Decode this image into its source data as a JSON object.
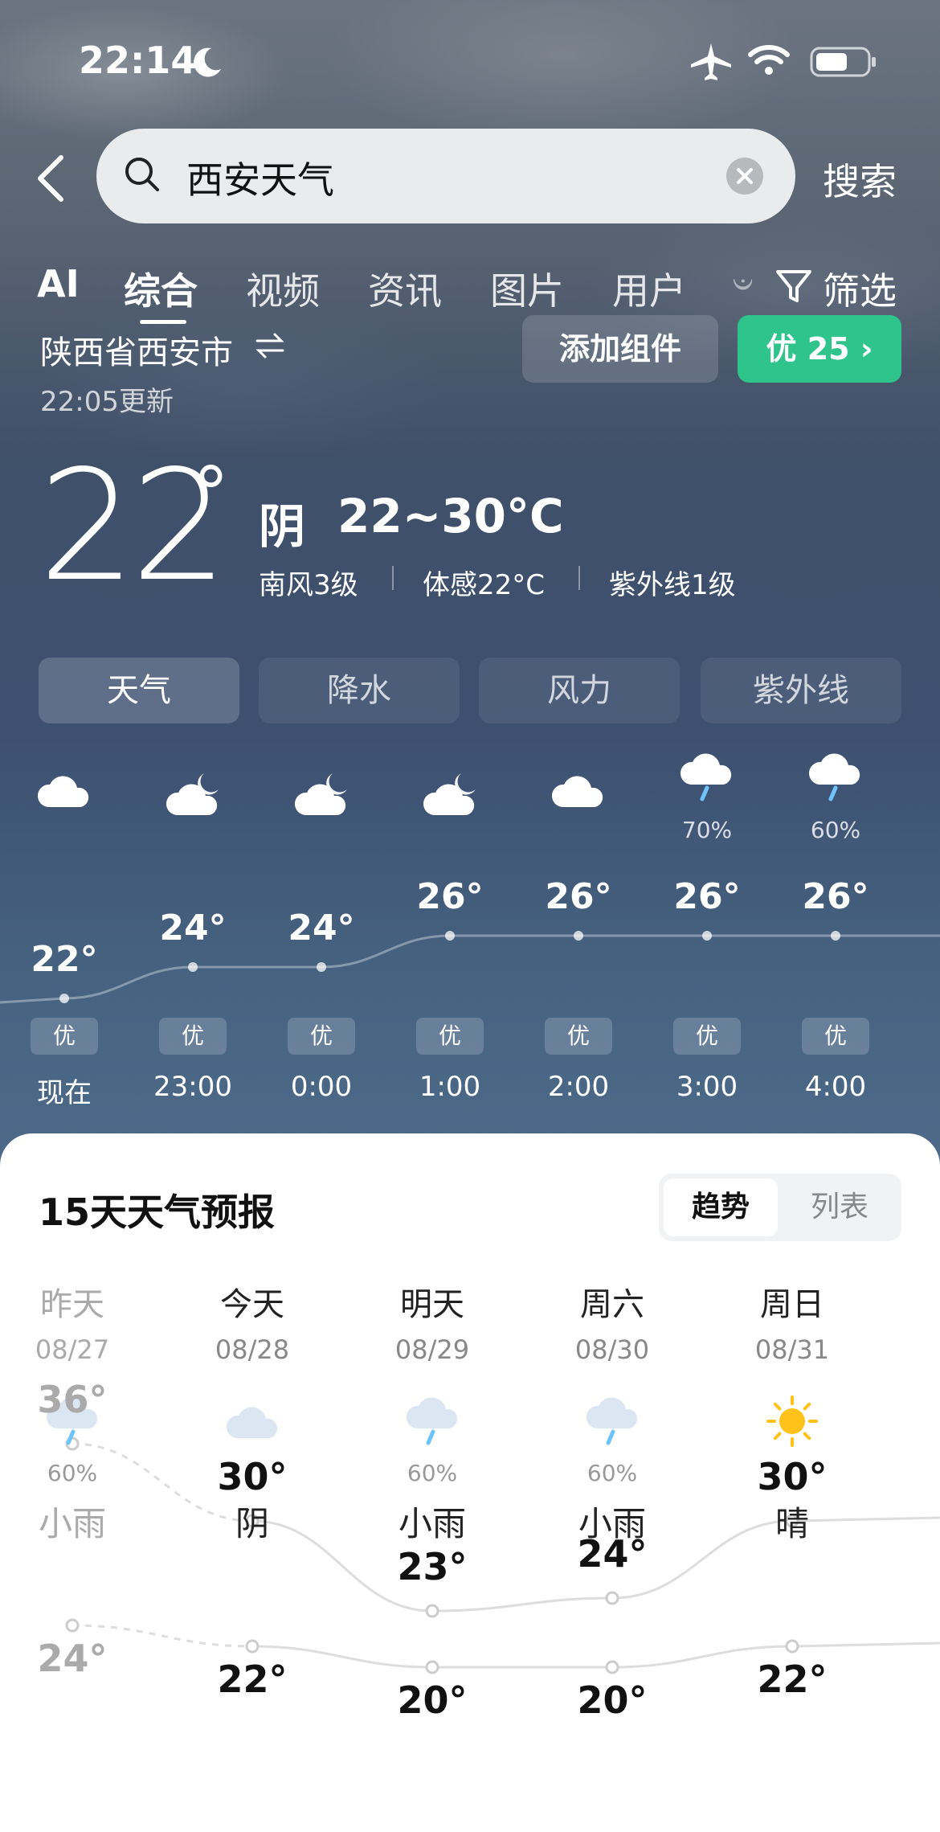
{
  "status_bar": {
    "time": "22:14"
  },
  "search": {
    "query": "西安天气",
    "submit_label": "搜索"
  },
  "tabs": [
    "AI",
    "综合",
    "视频",
    "资讯",
    "图片",
    "用户",
    "𝄑"
  ],
  "filter_label": "筛选",
  "location": {
    "name": "陕西省西安市",
    "updated": "22:05更新"
  },
  "widget_btn": "添加组件",
  "aqi_btn": "优 25 ›",
  "current": {
    "temp": "22",
    "degree": "°",
    "condition": "阴",
    "range": "22~30°C",
    "wind": "南风3级",
    "feels": "体感22°C",
    "uv": "紫外线1级"
  },
  "segments": [
    "天气",
    "降水",
    "风力",
    "紫外线"
  ],
  "hourly": [
    {
      "time": "现在",
      "temp": "22°",
      "aq": "优",
      "icon": "cloud-icon",
      "pct": ""
    },
    {
      "time": "23:00",
      "temp": "24°",
      "aq": "优",
      "icon": "cloud-moon-icon",
      "pct": ""
    },
    {
      "time": "0:00",
      "temp": "24°",
      "aq": "优",
      "icon": "cloud-moon-icon",
      "pct": ""
    },
    {
      "time": "1:00",
      "temp": "26°",
      "aq": "优",
      "icon": "cloud-moon-icon",
      "pct": ""
    },
    {
      "time": "2:00",
      "temp": "26°",
      "aq": "优",
      "icon": "cloud-icon",
      "pct": ""
    },
    {
      "time": "3:00",
      "temp": "26°",
      "aq": "优",
      "icon": "rain-icon",
      "pct": "70%"
    },
    {
      "time": "4:00",
      "temp": "26°",
      "aq": "优",
      "icon": "rain-icon",
      "pct": "60%"
    }
  ],
  "forecast": {
    "title": "15天天气预报",
    "toggle": [
      "趋势",
      "列表"
    ],
    "days": [
      {
        "name": "昨天",
        "date": "08/27",
        "cond": "小雨",
        "pct": "60%",
        "icon": "rain-icon",
        "high": "36°",
        "low": "24°"
      },
      {
        "name": "今天",
        "date": "08/28",
        "cond": "阴",
        "pct": "",
        "icon": "cloud-icon",
        "high": "30°",
        "low": "22°"
      },
      {
        "name": "明天",
        "date": "08/29",
        "cond": "小雨",
        "pct": "60%",
        "icon": "rain-icon",
        "high": "23°",
        "low": "20°"
      },
      {
        "name": "周六",
        "date": "08/30",
        "cond": "小雨",
        "pct": "60%",
        "icon": "rain-icon",
        "high": "24°",
        "low": "20°"
      },
      {
        "name": "周日",
        "date": "08/31",
        "cond": "晴",
        "pct": "",
        "icon": "sun-icon",
        "high": "30°",
        "low": "22°"
      }
    ]
  }
}
